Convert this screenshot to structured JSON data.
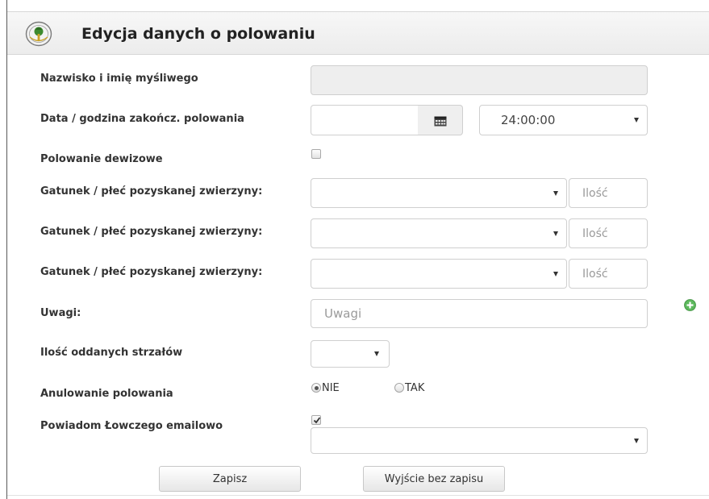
{
  "header": {
    "title": "Edycja danych o polowaniu",
    "logo_icon": "hunting-badge-icon"
  },
  "form": {
    "hunter_name": {
      "label": "Nazwisko i imię myśliwego",
      "value": ""
    },
    "end_datetime": {
      "label": "Data / godzina zakończ. polowania",
      "date_value": "",
      "calendar_icon": "calendar-icon",
      "time_value": "24:00:00"
    },
    "foreign_hunt": {
      "label": "Polowanie dewizowe",
      "checked": false
    },
    "game_rows": [
      {
        "label": "Gatunek / płeć pozyskanej zwierzyny:",
        "species_value": "",
        "qty_placeholder": "Ilość"
      },
      {
        "label": "Gatunek / płeć pozyskanej zwierzyny:",
        "species_value": "",
        "qty_placeholder": "Ilość"
      },
      {
        "label": "Gatunek / płeć pozyskanej zwierzyny:",
        "species_value": "",
        "qty_placeholder": "Ilość"
      }
    ],
    "add_icon": "plus-circle-icon",
    "notes": {
      "label": "Uwagi:",
      "placeholder": "Uwagi"
    },
    "shots": {
      "label": "Ilość oddanych strzałów",
      "value": ""
    },
    "cancel_hunt": {
      "label": "Anulowanie polowania",
      "options": [
        {
          "label": "NIE",
          "selected": true
        },
        {
          "label": "TAK",
          "selected": false
        }
      ]
    },
    "notify": {
      "label": "Powiadom Łowczego emailowo",
      "checked": true,
      "recipient_value": ""
    }
  },
  "actions": {
    "save_label": "Zapisz",
    "exit_label": "Wyjście bez zapisu"
  },
  "colors": {
    "header_bg": "#eeeeee",
    "input_border": "#cfcfcf",
    "readonly_bg": "#eeeeee",
    "accent_green": "#5cb85c",
    "placeholder": "#9a9a9a"
  }
}
